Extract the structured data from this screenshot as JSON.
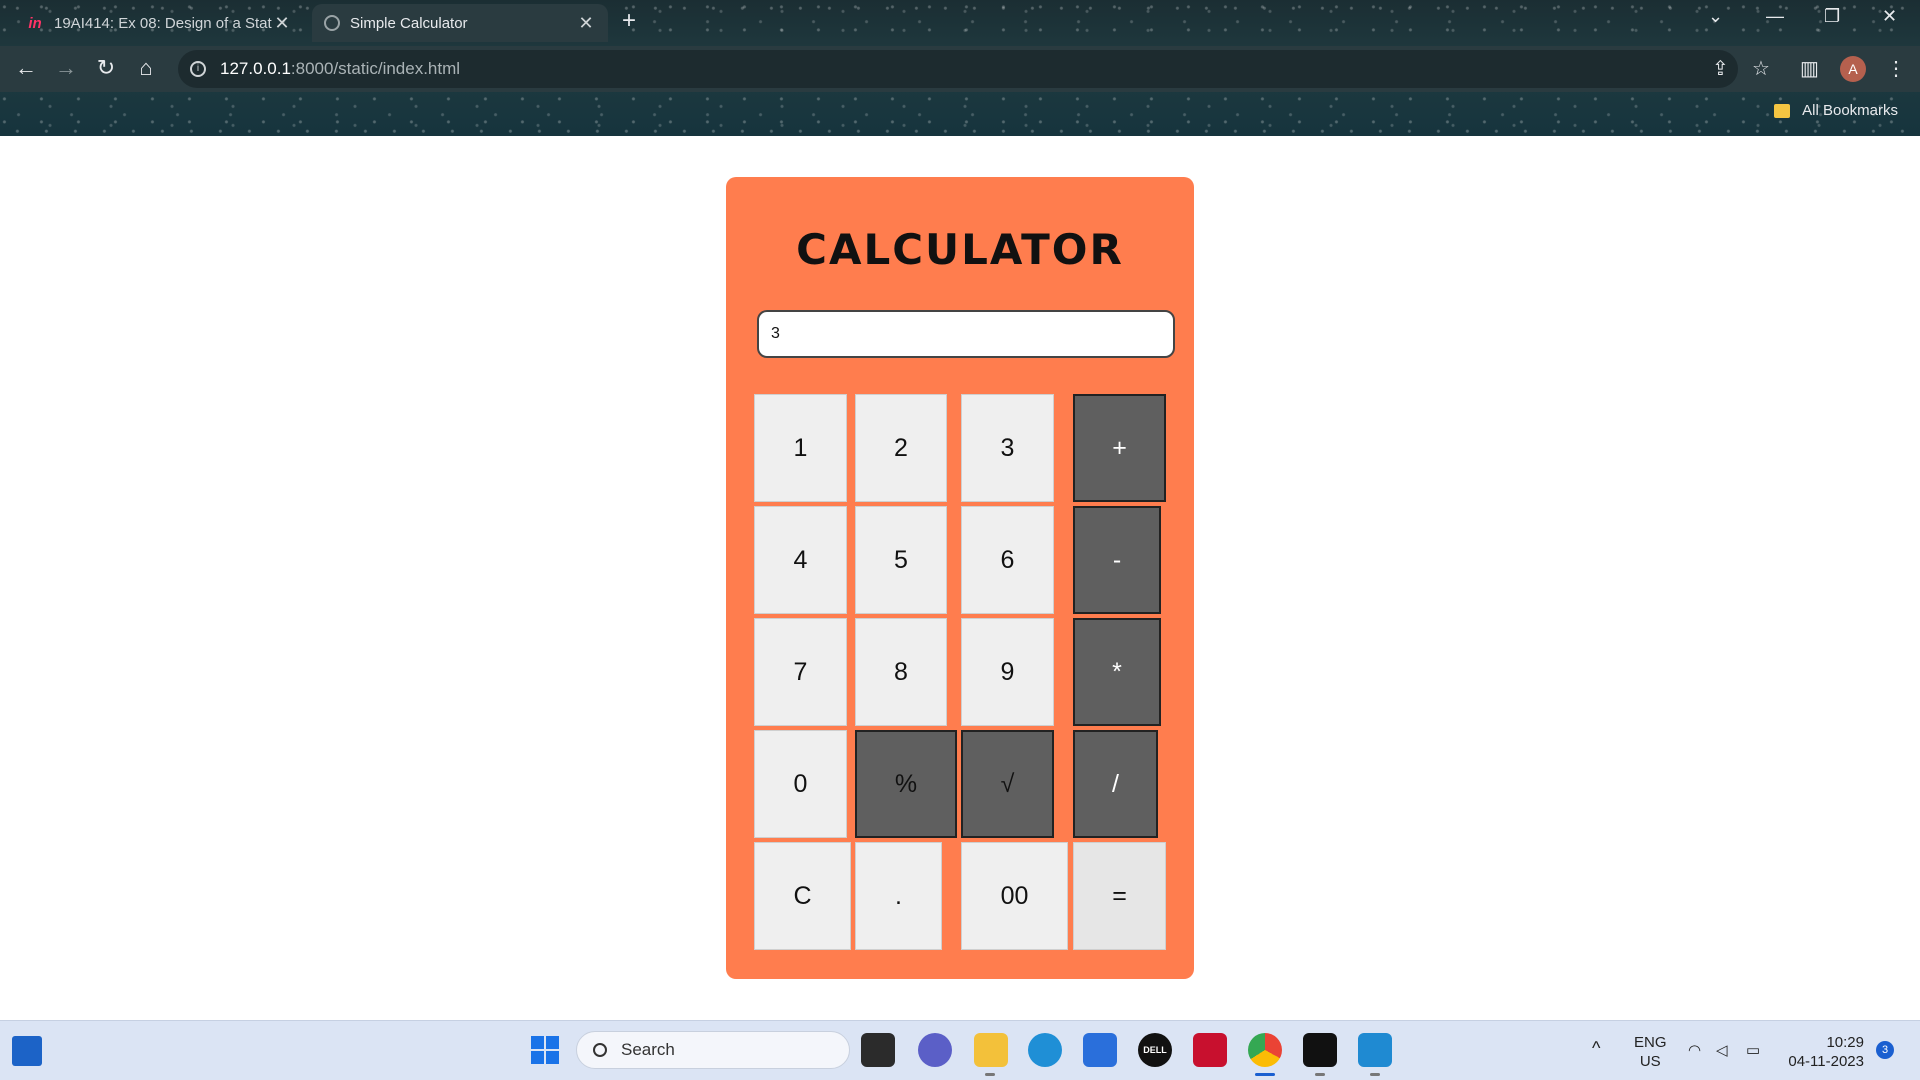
{
  "browser": {
    "tabs": [
      {
        "title": "19AI414: Ex 08: Design of a Stat",
        "favicon": "invision-icon",
        "favicon_text": "in",
        "active": false
      },
      {
        "title": "Simple Calculator",
        "favicon": "globe-icon",
        "active": true
      }
    ],
    "url": {
      "host": "127.0.0.1",
      "path": ":8000/static/index.html"
    },
    "bookmarks_label": "All Bookmarks",
    "profile_initial": "A"
  },
  "calculator": {
    "title": "CALCULATOR",
    "display_value": "3",
    "keys": {
      "k1": "1",
      "k2": "2",
      "k3": "3",
      "plus": "+",
      "k4": "4",
      "k5": "5",
      "k6": "6",
      "minus": "-",
      "k7": "7",
      "k8": "8",
      "k9": "9",
      "multiply": "*",
      "k0": "0",
      "percent": "%",
      "sqrt": "√",
      "divide": "/",
      "clear": "C",
      "dot": ".",
      "k00": "00",
      "equals": "="
    },
    "colors": {
      "panel": "#ff7d4e",
      "operator_key": "#5f5f5f",
      "number_key": "#efefef"
    }
  },
  "taskbar": {
    "search_label": "Search",
    "language": "ENG",
    "region": "US",
    "time": "10:29",
    "date": "04-11-2023",
    "notification_count": "3"
  }
}
